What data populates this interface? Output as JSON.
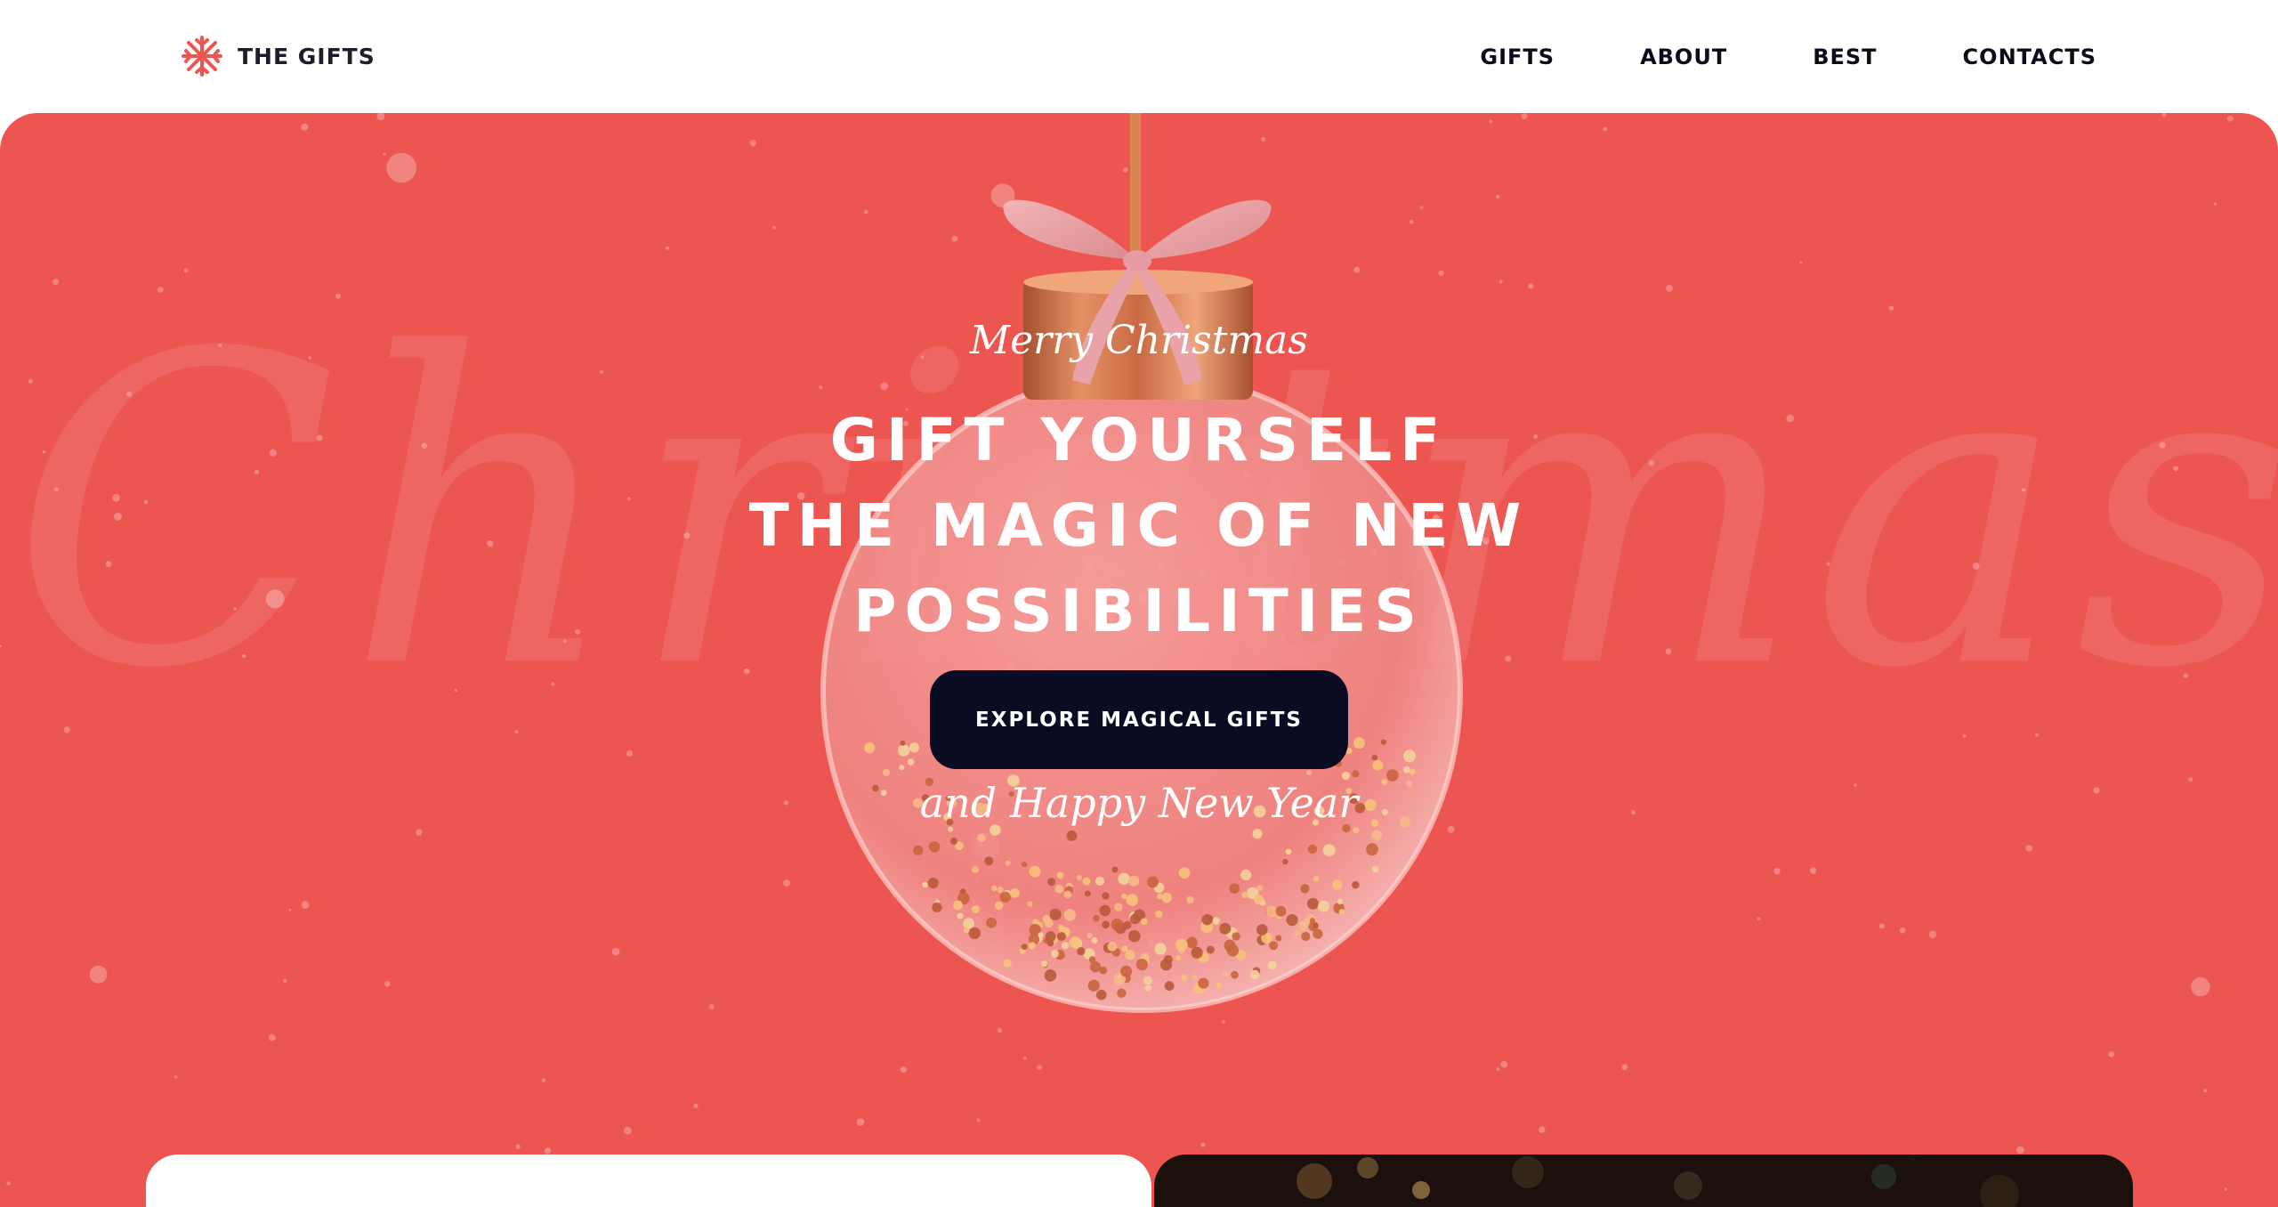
{
  "header": {
    "logo_icon": "snowflake-icon",
    "logo_text": "THE GIFTS",
    "nav": [
      {
        "label": "GIFTS"
      },
      {
        "label": "ABOUT"
      },
      {
        "label": "BEST"
      },
      {
        "label": "CONTACTS"
      }
    ]
  },
  "hero": {
    "watermark": "Christmas",
    "subtitle_top": "Merry Christmas",
    "headline": [
      "GIFT YOURSELF",
      "THE MAGIC OF NEW",
      "POSSIBILITIES"
    ],
    "cta_label": "EXPLORE MAGICAL GIFTS",
    "subtitle_bottom": "and Happy New Year",
    "ornament_icon": "christmas-ornament-icon"
  },
  "colors": {
    "hero_background": "#ec5550",
    "cta_background": "#0a0c24",
    "logo_accent": "#ec5550",
    "nav_text": "#0b0b1a"
  }
}
